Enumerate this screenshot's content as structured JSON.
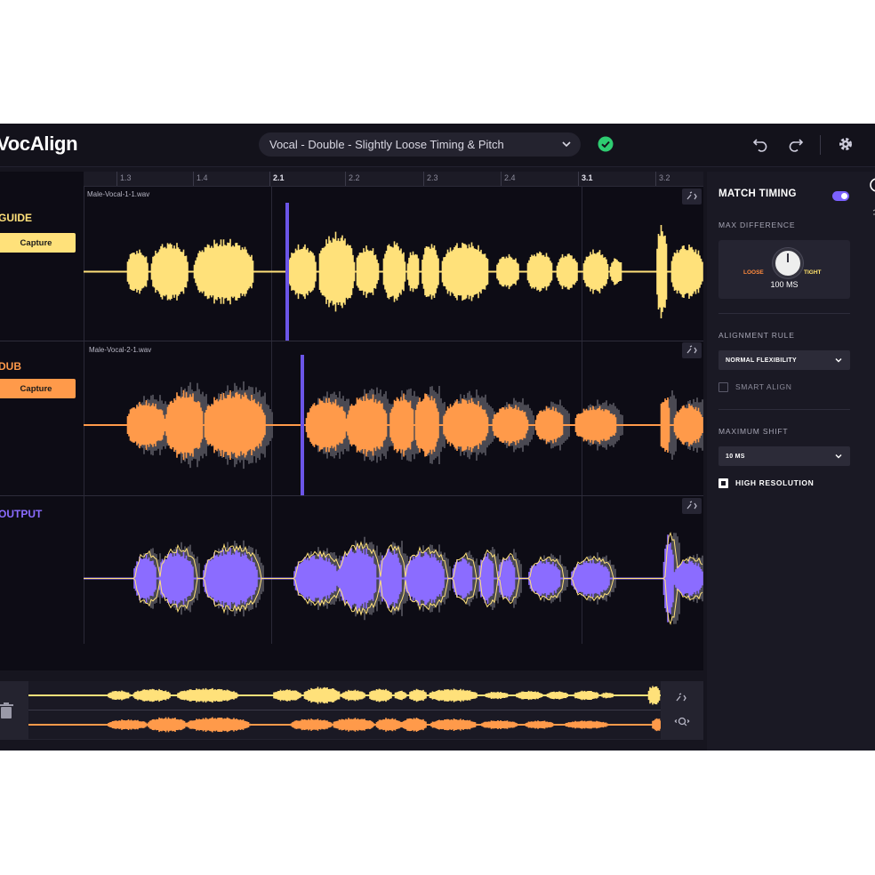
{
  "app": {
    "title": "VocAlign"
  },
  "header": {
    "preset_value": "Vocal - Double - Slightly Loose Timing & Pitch",
    "undo_icon": "undo-icon",
    "redo_icon": "redo-icon",
    "settings_icon": "gear-icon",
    "status_icon": "check-circle-icon"
  },
  "ruler": {
    "ticks": [
      {
        "label": "1.3",
        "major": false
      },
      {
        "label": "1.4",
        "major": false
      },
      {
        "label": "2.1",
        "major": true
      },
      {
        "label": "2.2",
        "major": false
      },
      {
        "label": "2.3",
        "major": false
      },
      {
        "label": "2.4",
        "major": false
      },
      {
        "label": "3.1",
        "major": true
      },
      {
        "label": "3.2",
        "major": false
      }
    ]
  },
  "tracks": {
    "guide": {
      "name": "GUIDE",
      "button": "Capture",
      "file": "Male-Vocal-1-1.wav",
      "color": "#ffe17a"
    },
    "dub": {
      "name": "DUB",
      "button": "Capture",
      "file": "Male-Vocal-2-1.wav",
      "color": "#ff9a4a"
    },
    "output": {
      "name": "OUTPUT",
      "color": "#8b6cff"
    }
  },
  "panel": {
    "match_timing": "MATCH TIMING",
    "match_timing_on": true,
    "max_difference_label": "MAX DIFFERENCE",
    "knob_loose": "LOOSE",
    "knob_tight": "TIGHT",
    "knob_value": "100 MS",
    "alignment_rule_label": "ALIGNMENT RULE",
    "alignment_rule_value": "NORMAL FLEXIBILITY",
    "smart_align": "SMART ALIGN",
    "smart_align_checked": false,
    "maximum_shift_label": "MAXIMUM SHIFT",
    "maximum_shift_value": "10 MS",
    "high_resolution": "HIGH RESOLUTION",
    "high_resolution_checked": true
  },
  "colors": {
    "accent": "#7b61ff",
    "guide": "#ffe17a",
    "dub": "#ff9a4a",
    "output": "#8b6cff"
  }
}
